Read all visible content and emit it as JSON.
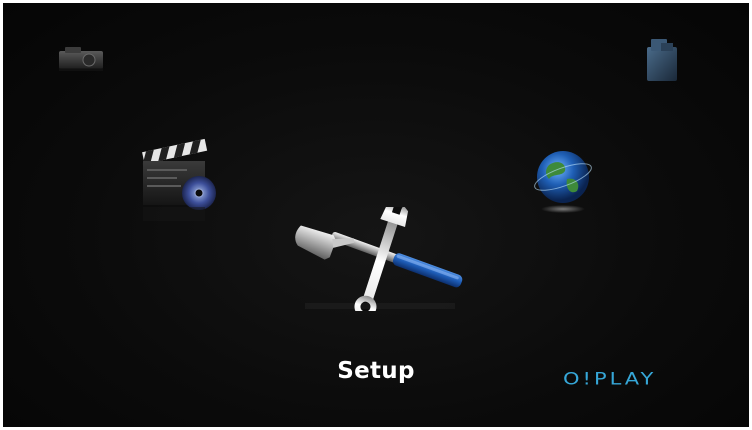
{
  "menu": {
    "selected_label": "Setup",
    "items": [
      {
        "id": "photo",
        "icon": "camera-icon"
      },
      {
        "id": "music",
        "icon": "music-folder-icon"
      },
      {
        "id": "movie",
        "icon": "clapperboard-disc-icon"
      },
      {
        "id": "internet",
        "icon": "globe-icon"
      },
      {
        "id": "setup",
        "icon": "hammer-wrench-icon",
        "selected": true
      }
    ]
  },
  "brand": {
    "logo_text": "O!PLAY",
    "color": "#36a7d8"
  }
}
